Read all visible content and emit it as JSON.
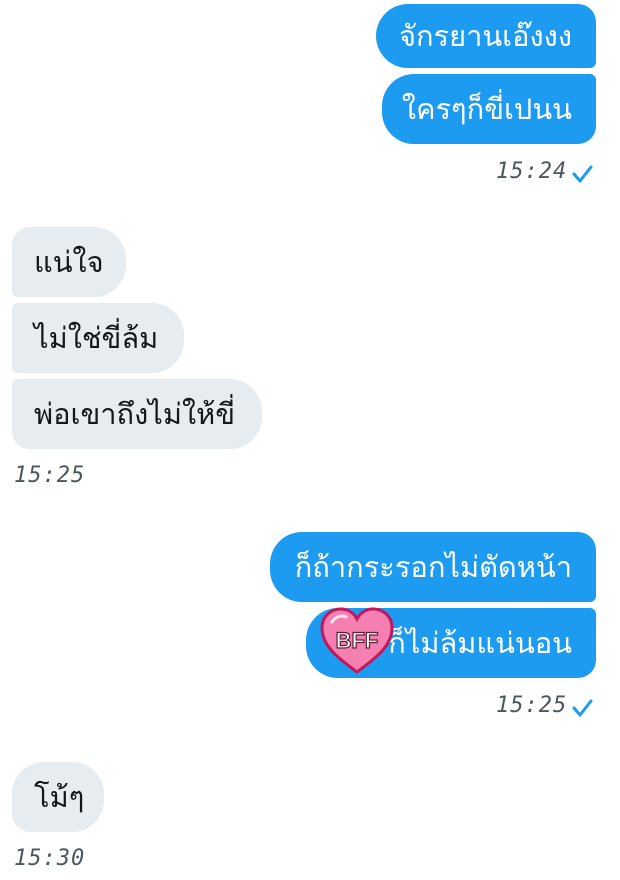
{
  "messages": [
    {
      "text": "จักรยานเอ๊งงง"
    },
    {
      "text": "ใครๆก็ขี่เปนน"
    },
    {
      "time": "15:24"
    },
    {
      "text": "แน่ใจ"
    },
    {
      "text": "ไม่ใช่ขี่ล้ม"
    },
    {
      "text": "พ่อเขาถึงไม่ให้ขี่"
    },
    {
      "time": "15:25"
    },
    {
      "text": "ก็ถ้ากระรอกไม่ตัดหน้า"
    },
    {
      "text": "ก็ไม่ล้มแน่นอน",
      "sticker": "BFF"
    },
    {
      "time": "15:25"
    },
    {
      "text": "โม้ๆ"
    },
    {
      "time": "15:30"
    }
  ],
  "colors": {
    "outgoing_bubble": "#1d9bf0",
    "incoming_bubble": "#e6ecf0",
    "sticker_heart": "#f47fb0"
  },
  "icons": {
    "read_receipt": "check-icon",
    "sticker": "bff-heart-sticker"
  }
}
